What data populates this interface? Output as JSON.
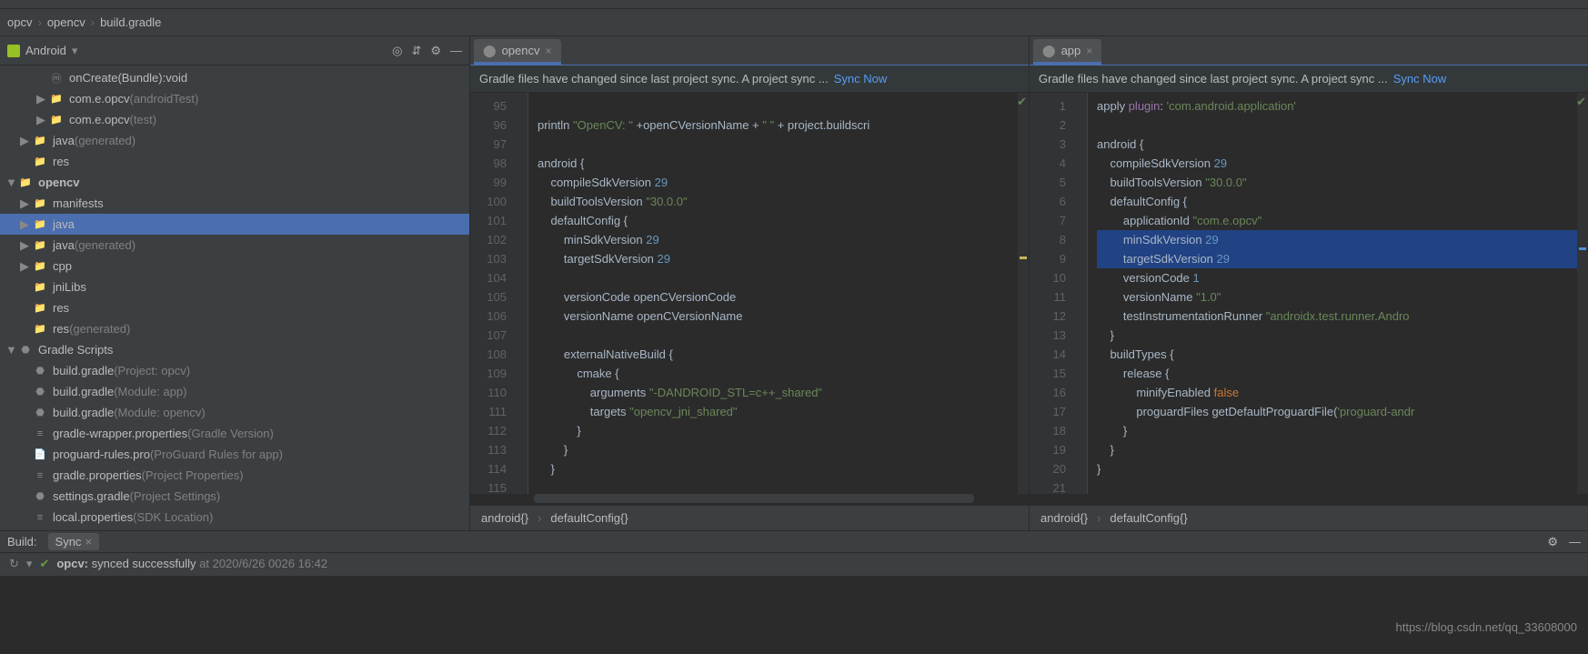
{
  "breadcrumb": [
    "opcv",
    "opencv",
    "build.gradle"
  ],
  "sidebar": {
    "title": "Android",
    "items": [
      {
        "indent": 2,
        "arrow": "",
        "icon": "m",
        "label": "onCreate(Bundle):void",
        "dim": ""
      },
      {
        "indent": 2,
        "arrow": "▶",
        "icon": "folder",
        "label": "com.e.opcv",
        "dim": "(androidTest)"
      },
      {
        "indent": 2,
        "arrow": "▶",
        "icon": "folder",
        "label": "com.e.opcv",
        "dim": "(test)"
      },
      {
        "indent": 1,
        "arrow": "▶",
        "icon": "folder-gen",
        "label": "java",
        "dim": "(generated)"
      },
      {
        "indent": 1,
        "arrow": "",
        "icon": "folder-res",
        "label": "res",
        "dim": ""
      },
      {
        "indent": 0,
        "arrow": "▼",
        "icon": "folder-mod",
        "label": "opencv",
        "dim": "",
        "bold": true
      },
      {
        "indent": 1,
        "arrow": "▶",
        "icon": "folder-blue",
        "label": "manifests",
        "dim": ""
      },
      {
        "indent": 1,
        "arrow": "▶",
        "icon": "folder-blue",
        "label": "java",
        "dim": "",
        "selected": true
      },
      {
        "indent": 1,
        "arrow": "▶",
        "icon": "folder-gen",
        "label": "java",
        "dim": "(generated)"
      },
      {
        "indent": 1,
        "arrow": "▶",
        "icon": "folder-blue",
        "label": "cpp",
        "dim": ""
      },
      {
        "indent": 1,
        "arrow": "",
        "icon": "folder-gen",
        "label": "jniLibs",
        "dim": ""
      },
      {
        "indent": 1,
        "arrow": "",
        "icon": "folder-res",
        "label": "res",
        "dim": ""
      },
      {
        "indent": 1,
        "arrow": "",
        "icon": "folder-res",
        "label": "res",
        "dim": "(generated)"
      },
      {
        "indent": 0,
        "arrow": "▼",
        "icon": "gradle",
        "label": "Gradle Scripts",
        "dim": ""
      },
      {
        "indent": 1,
        "arrow": "",
        "icon": "gradle",
        "label": "build.gradle",
        "dim": "(Project: opcv)"
      },
      {
        "indent": 1,
        "arrow": "",
        "icon": "gradle",
        "label": "build.gradle",
        "dim": "(Module: app)"
      },
      {
        "indent": 1,
        "arrow": "",
        "icon": "gradle",
        "label": "build.gradle",
        "dim": "(Module: opencv)"
      },
      {
        "indent": 1,
        "arrow": "",
        "icon": "prop",
        "label": "gradle-wrapper.properties",
        "dim": "(Gradle Version)"
      },
      {
        "indent": 1,
        "arrow": "",
        "icon": "file",
        "label": "proguard-rules.pro",
        "dim": "(ProGuard Rules for app)"
      },
      {
        "indent": 1,
        "arrow": "",
        "icon": "prop",
        "label": "gradle.properties",
        "dim": "(Project Properties)"
      },
      {
        "indent": 1,
        "arrow": "",
        "icon": "gradle",
        "label": "settings.gradle",
        "dim": "(Project Settings)"
      },
      {
        "indent": 1,
        "arrow": "",
        "icon": "prop",
        "label": "local.properties",
        "dim": "(SDK Location)"
      }
    ]
  },
  "editor_left": {
    "tab": "opencv",
    "banner": "Gradle files have changed since last project sync. A project sync ...",
    "sync": "Sync Now",
    "first_line": 95,
    "lines": [
      "",
      "println <span class='str'>\"OpenCV: \"</span> +openCVersionName + <span class='str'>\" \"</span> + project.buildscri",
      "",
      "android {",
      "    compileSdkVersion <span class='num'>29</span>",
      "    buildToolsVersion <span class='str'>\"30.0.0\"</span>",
      "    defaultConfig {",
      "        minSdkVersion <span class='num'>29</span>",
      "        targetSdkVersion <span class='num'>29</span>",
      "",
      "        versionCode openCVersionCode",
      "        versionName openCVersionName",
      "",
      "        externalNativeBuild {",
      "            cmake {",
      "                arguments <span class='str'>\"-DANDROID_STL=c++_shared\"</span>",
      "                targets <span class='str'>\"opencv_jni_shared\"</span>",
      "            }",
      "        }",
      "    }",
      ""
    ],
    "crumbs": [
      "android{}",
      "defaultConfig{}"
    ]
  },
  "editor_right": {
    "tab": "app",
    "banner": "Gradle files have changed since last project sync. A project sync ...",
    "sync": "Sync Now",
    "first_line": 1,
    "lines": [
      "apply <span class='id'>plugin</span>: <span class='str'>'com.android.application'</span>",
      "",
      "android {",
      "    compileSdkVersion <span class='num'>29</span>",
      "    buildToolsVersion <span class='str'>\"30.0.0\"</span>",
      "    defaultConfig {",
      "        applicationId <span class='str'>\"com.e.opcv\"</span>",
      "        minSdkVersion <span class='num'>29</span>",
      "        targetSdkVersion <span class='num'>29</span>",
      "        versionCode <span class='num'>1</span>",
      "        versionName <span class='str'>\"1.0\"</span>",
      "        testInstrumentationRunner <span class='str'>\"androidx.test.runner.Andro</span>",
      "    }",
      "    buildTypes {",
      "        release {",
      "            minifyEnabled <span class='kw'>false</span>",
      "            proguardFiles getDefaultProguardFile(<span class='str'>'proguard-andr</span>",
      "        }",
      "    }",
      "}",
      ""
    ],
    "highlighted": [
      7,
      8
    ],
    "crumbs": [
      "android{}",
      "defaultConfig{}"
    ]
  },
  "bottom": {
    "label": "Build:",
    "tab": "Sync",
    "status_title": "opcv:",
    "status_text": " synced successfully",
    "status_time": "at 2020/6/26 0026 16:42"
  },
  "watermark": "https://blog.csdn.net/qq_33608000"
}
